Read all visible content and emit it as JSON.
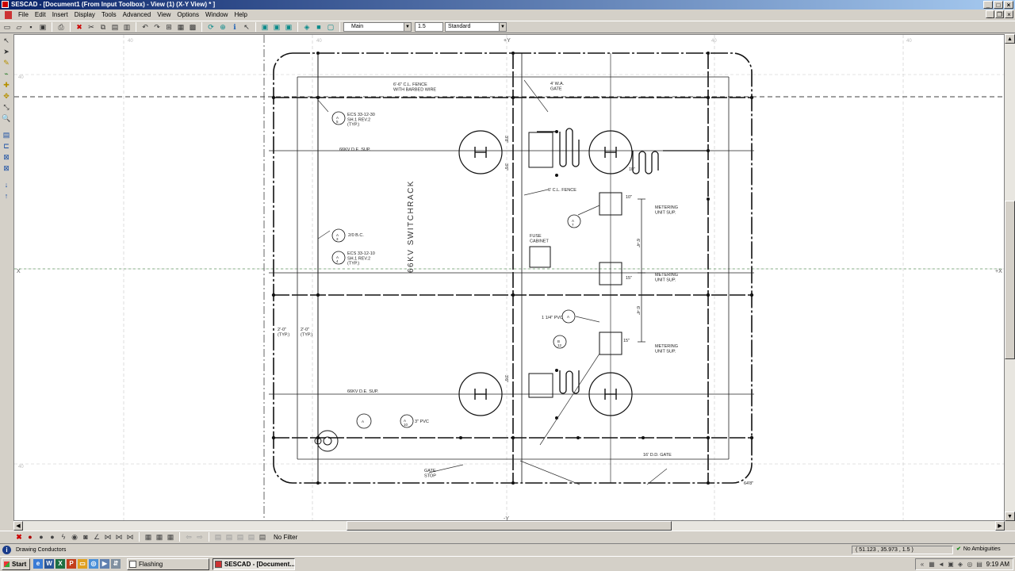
{
  "window": {
    "title": "SESCAD - [Document1 (From Input Toolbox) - View (1) (X-Y View) * ]"
  },
  "menu": [
    "File",
    "Edit",
    "Insert",
    "Display",
    "Tools",
    "Advanced",
    "View",
    "Options",
    "Window",
    "Help"
  ],
  "toolbar": {
    "layer_combo": "Main",
    "width_combo": "1.5",
    "style_combo": "Standard"
  },
  "drawing": {
    "axis_top": "+Y",
    "axis_bottom": "-Y",
    "axis_left": "X",
    "axis_right": "+X",
    "fence_top": "6'-6\" C.L. FENCE\nWITH BARBED WIRE",
    "gate_top": "4' W.A.\nGATE",
    "ecs_top": "ECS 33-12-30\nSH.1 REV.2\n(TYP.)",
    "sup_66kv_top": "66KV D.E. SUP.",
    "cl_fence": "6' C.L. FENCE",
    "metering_1": "METERING\nUNIT SUP.",
    "metering_2": "METERING\nUNIT SUP.",
    "metering_3": "METERING\nUNIT SUP.",
    "switchrack": "66KV SWITCHRACK",
    "bare_cu": "2/0 B.C.",
    "ecs_mid": "ECS 33-12-10\nSH.1 REV.2\n(TYP.)",
    "fuse_cabinet": "FUSE\nCABINET",
    "pvc_label": "1 1/4\" PVC",
    "dim_left_1": "2'-0\"\n(TYP.)",
    "dim_left_2": "2'-0\"\n(TYP.)",
    "sup_66kv_bottom": "66KV D.E. SUP.",
    "pvc_bottom": "3\" PVC",
    "gate_stop": "GATE\nSTOP",
    "dd_gate": "16' D.D. GATE",
    "dim_6_4_a": "6'-4\"",
    "dim_6_4_b": "6'-4\"",
    "dim_64": "64'8\"",
    "dim_10_a": "10\"",
    "dim_15_a": "15\"",
    "dim_15_b": "15\"",
    "dim_7_a": "3'8\"",
    "dim_7_b": "3'6\"",
    "dim_7_c": "3'6\"",
    "dim_10_b": "10\"",
    "callout_a": "A",
    "callout_a1": "A\n5",
    "callout_a2": "A\n3",
    "callout_a3": "A\n4",
    "callout_a4": "A\n10",
    "callout_a5": "A\n7",
    "callout_a6": "A",
    "callout_b": "B\n12",
    "grid_ticks": [
      "40",
      "40",
      "40",
      "40",
      "40",
      "40"
    ]
  },
  "bottom": {
    "filter": "No Filter"
  },
  "status": {
    "message": "Drawing Conductors",
    "coords": "( 51.123 , 35.973 , 1.5 )",
    "ambiguities": "No Ambiguities"
  },
  "taskbar": {
    "start": "Start",
    "task1": "Flashing",
    "task2": "SESCAD - [Document...",
    "clock": "9:19 AM"
  },
  "colors": {
    "title_start": "#0a246a",
    "title_end": "#a6caf0",
    "canvas": "#ffffff"
  },
  "icons": {
    "toolbar": [
      "new-icon",
      "open-icon",
      "save-icon",
      "save-all-icon",
      "print-icon",
      "delete-icon",
      "cut-icon",
      "copy-icon",
      "paste-icon",
      "paste-special-icon",
      "undo-icon",
      "redo-icon",
      "zoom-icon",
      "grid-icon",
      "select-icon",
      "snap-icon",
      "info-icon",
      "select-pointer-icon",
      "view-front-icon",
      "view-side-icon",
      "view-top-icon",
      "view-3d-icon",
      "render-icon",
      "wireframe-icon"
    ],
    "palette": [
      "pointer-icon",
      "select-arrow-icon",
      "pencil-icon",
      "conductor-icon",
      "add-icon",
      "move-icon",
      "scale-icon",
      "zoom-icon",
      "chart-icon",
      "pipe-icon",
      "cross-icon",
      "box-icon",
      "down-arrow-icon",
      "up-arrow-icon"
    ],
    "bottom": [
      "close-red-icon",
      "record-icon",
      "circle-icon",
      "circle2-icon",
      "lightning-icon",
      "sphere-icon",
      "cube-icon",
      "angle-icon",
      "link1-icon",
      "link2-icon",
      "link3-icon",
      "grid1-icon",
      "grid2-icon",
      "grid3-icon",
      "back-icon",
      "forward-icon",
      "page1-icon",
      "page2-icon",
      "page3-icon",
      "page4-icon",
      "page5-icon"
    ]
  }
}
